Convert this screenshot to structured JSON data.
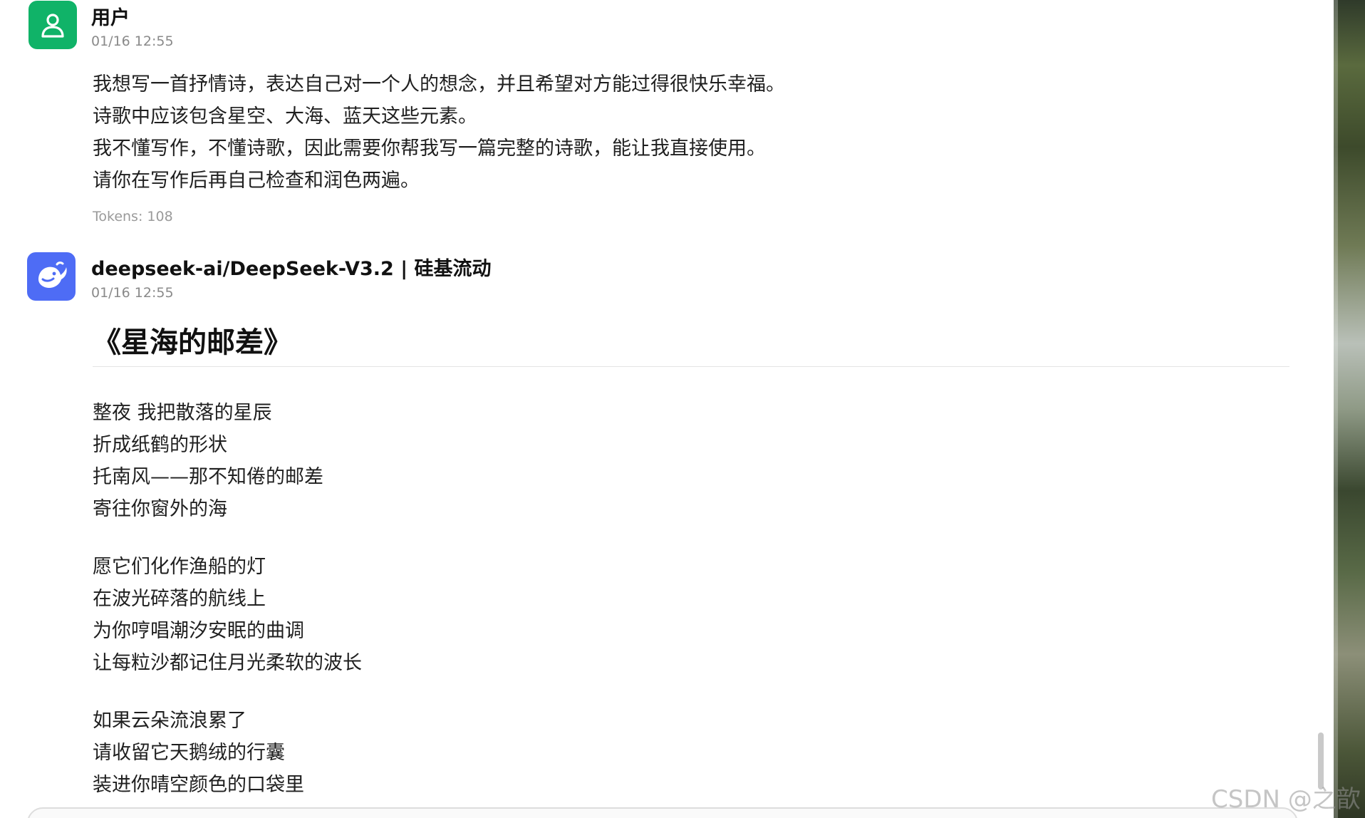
{
  "user_message": {
    "avatar_icon": "user-icon",
    "name": "用户",
    "time": "01/16 12:55",
    "lines": [
      "我想写一首抒情诗，表达自己对一个人的想念，并且希望对方能过得很快乐幸福。",
      "诗歌中应该包含星空、大海、蓝天这些元素。",
      "我不懂写作，不懂诗歌，因此需要你帮我写一篇完整的诗歌，能让我直接使用。",
      "请你在写作后再自己检查和润色两遍。"
    ],
    "tokens": "Tokens: 108"
  },
  "bot_message": {
    "avatar_icon": "deepseek-whale-icon",
    "name": "deepseek-ai/DeepSeek-V3.2 | 硅基流动",
    "time": "01/16 12:55",
    "poem_title": "《星海的邮差》",
    "stanzas": [
      [
        "整夜 我把散落的星辰",
        "折成纸鹤的形状",
        "托南风——那不知倦的邮差",
        "寄往你窗外的海"
      ],
      [
        "愿它们化作渔船的灯",
        "在波光碎落的航线上",
        "为你哼唱潮汐安眠的曲调",
        "让每粒沙都记住月光柔软的波长"
      ],
      [
        "如果云朵流浪累了",
        "请收留它天鹅绒的行囊",
        "装进你晴空颜色的口袋里"
      ]
    ]
  },
  "watermark": "CSDN @之歆",
  "colors": {
    "user_avatar": "#10b368",
    "bot_avatar": "#4e6cf5"
  }
}
